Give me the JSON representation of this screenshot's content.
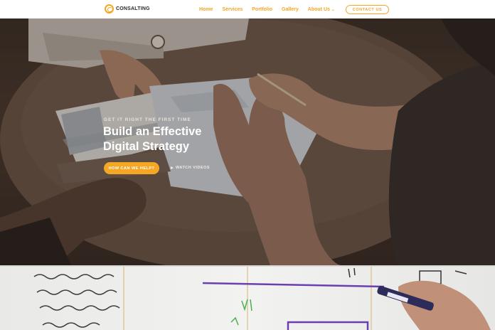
{
  "header": {
    "logo_text": "CONSALTING",
    "nav": [
      {
        "label": "Home"
      },
      {
        "label": "Services"
      },
      {
        "label": "Portfolio"
      },
      {
        "label": "Gallery"
      },
      {
        "label": "About Us",
        "has_dropdown": true
      }
    ],
    "contact_label": "CONTACT US"
  },
  "hero": {
    "eyebrow": "GET IT RIGHT THE FIRST TIME",
    "title_line1": "Build an Effective",
    "title_line2": "Digital Strategy",
    "cta_label": "HOW CAN WE HELP?",
    "video_label": "WATCH VIDEOS"
  },
  "colors": {
    "accent": "#f5a623",
    "header_bg": "#ffffff",
    "hero_text": "#ffffff"
  }
}
